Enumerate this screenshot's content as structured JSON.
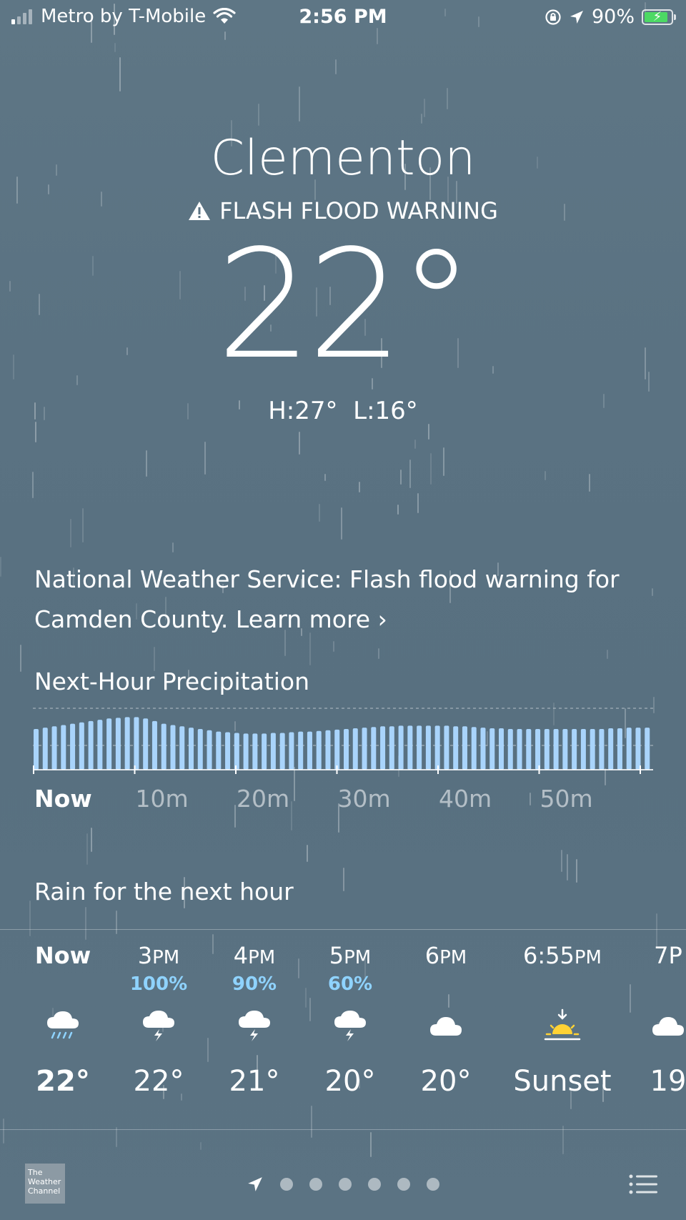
{
  "status_bar": {
    "carrier": "Metro by T-Mobile",
    "time": "2:56 PM",
    "battery": "90%",
    "battery_level": 0.9
  },
  "location": {
    "city": "Clementon",
    "alert": "FLASH FLOOD WARNING"
  },
  "current": {
    "temperature": "22°",
    "high": "H:27°",
    "low": "L:16°"
  },
  "notice": {
    "text": "National Weather Service: Flash flood warning for Camden County.",
    "link": "Learn more"
  },
  "precipitation": {
    "title": "Next-Hour Precipitation",
    "description": "Rain for the next hour",
    "axis_labels": [
      "Now",
      "10m",
      "20m",
      "30m",
      "40m",
      "50m"
    ],
    "intensity": [
      0.62,
      0.64,
      0.66,
      0.68,
      0.7,
      0.72,
      0.74,
      0.76,
      0.78,
      0.79,
      0.8,
      0.8,
      0.78,
      0.74,
      0.7,
      0.68,
      0.66,
      0.64,
      0.62,
      0.6,
      0.58,
      0.57,
      0.56,
      0.55,
      0.55,
      0.55,
      0.56,
      0.56,
      0.57,
      0.58,
      0.58,
      0.59,
      0.6,
      0.61,
      0.62,
      0.63,
      0.64,
      0.65,
      0.66,
      0.66,
      0.67,
      0.67,
      0.67,
      0.67,
      0.67,
      0.67,
      0.66,
      0.66,
      0.65,
      0.64,
      0.63,
      0.63,
      0.62,
      0.62,
      0.62,
      0.62,
      0.62,
      0.62,
      0.62,
      0.62,
      0.62,
      0.62,
      0.62,
      0.63,
      0.63,
      0.64,
      0.64,
      0.64
    ]
  },
  "hourly": [
    {
      "time": "Now",
      "pct": "",
      "icon": "rain-cloud-icon",
      "temp": "22°"
    },
    {
      "time": "3PM",
      "pct": "100%",
      "icon": "thunderstorm-icon",
      "temp": "22°"
    },
    {
      "time": "4PM",
      "pct": "90%",
      "icon": "thunderstorm-icon",
      "temp": "21°"
    },
    {
      "time": "5PM",
      "pct": "60%",
      "icon": "thunderstorm-icon",
      "temp": "20°"
    },
    {
      "time": "6PM",
      "pct": "",
      "icon": "cloud-icon",
      "temp": "20°"
    },
    {
      "time": "6:55PM",
      "pct": "",
      "icon": "sunset-icon",
      "temp": "Sunset"
    },
    {
      "time": "7P",
      "pct": "",
      "icon": "cloud-icon",
      "temp": "19"
    }
  ],
  "footer": {
    "provider": "The Weather Channel",
    "page_count": 6
  },
  "colors": {
    "precip_bar": "#a9d4fb",
    "probability": "#8fd3ff",
    "sun": "#ffd234"
  }
}
